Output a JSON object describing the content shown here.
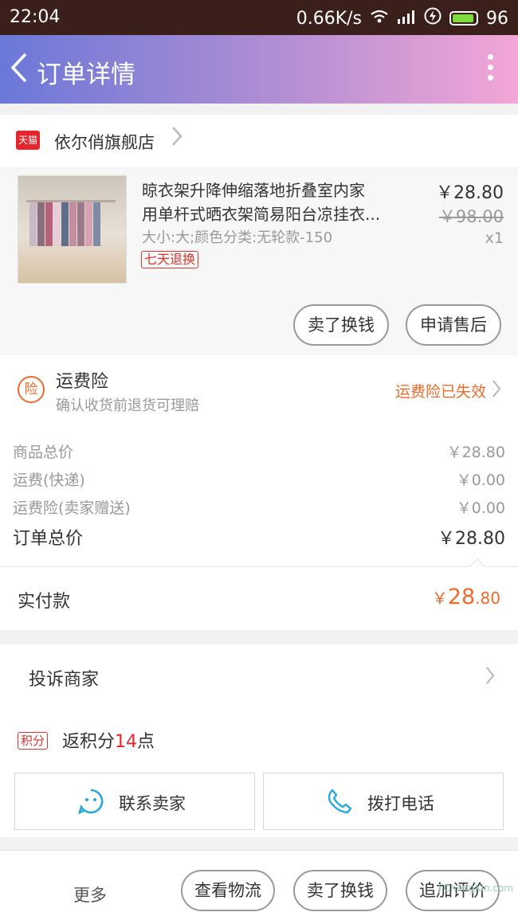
{
  "status": {
    "time": "22:04",
    "speed": "0.66K/s",
    "battery": "96"
  },
  "header": {
    "title": "订单详情"
  },
  "shop": {
    "badge": "天猫",
    "name": "依尔俏旗舰店"
  },
  "item": {
    "name_line1": "晾衣架升降伸缩落地折叠室内家",
    "name_line2": "用单杆式晒衣架简易阳台凉挂衣...",
    "spec": "大小:大;颜色分类:无轮款-150",
    "return_badge": "七天退换",
    "price": "￥28.80",
    "orig_price": "￥98.00",
    "qty": "x1",
    "btn_sell": "卖了换钱",
    "btn_aftersale": "申请售后"
  },
  "insurance": {
    "icon_char": "险",
    "title": "运费险",
    "subtitle": "确认收货前退货可理赔",
    "status": "运费险已失效"
  },
  "costs": {
    "goods_label": "商品总价",
    "goods_value": "￥28.80",
    "ship_label": "运费(快递)",
    "ship_value": "￥0.00",
    "ins_label": "运费险(卖家赠送)",
    "ins_value": "￥0.00",
    "total_label": "订单总价",
    "total_value": "￥28.80"
  },
  "paid": {
    "label": "实付款",
    "currency": "￥",
    "int": "28",
    "dec": ".80"
  },
  "actions": {
    "complain": "投诉商家",
    "points_badge": "积分",
    "points_pre": "返积分",
    "points_num": "14",
    "points_post": "点",
    "contact_seller": "联系卖家",
    "call_phone": "拨打电话"
  },
  "bottom": {
    "more": "更多",
    "logistics": "查看物流",
    "sell": "卖了换钱",
    "review": "追加评价"
  },
  "watermark": "JiChengXin.com",
  "colors": {
    "accent": "#f06a2b",
    "tmall_red": "#e5252c",
    "header_start": "#6a78d8",
    "header_end": "#f3a6d7",
    "icon_blue": "#29a8e0"
  }
}
